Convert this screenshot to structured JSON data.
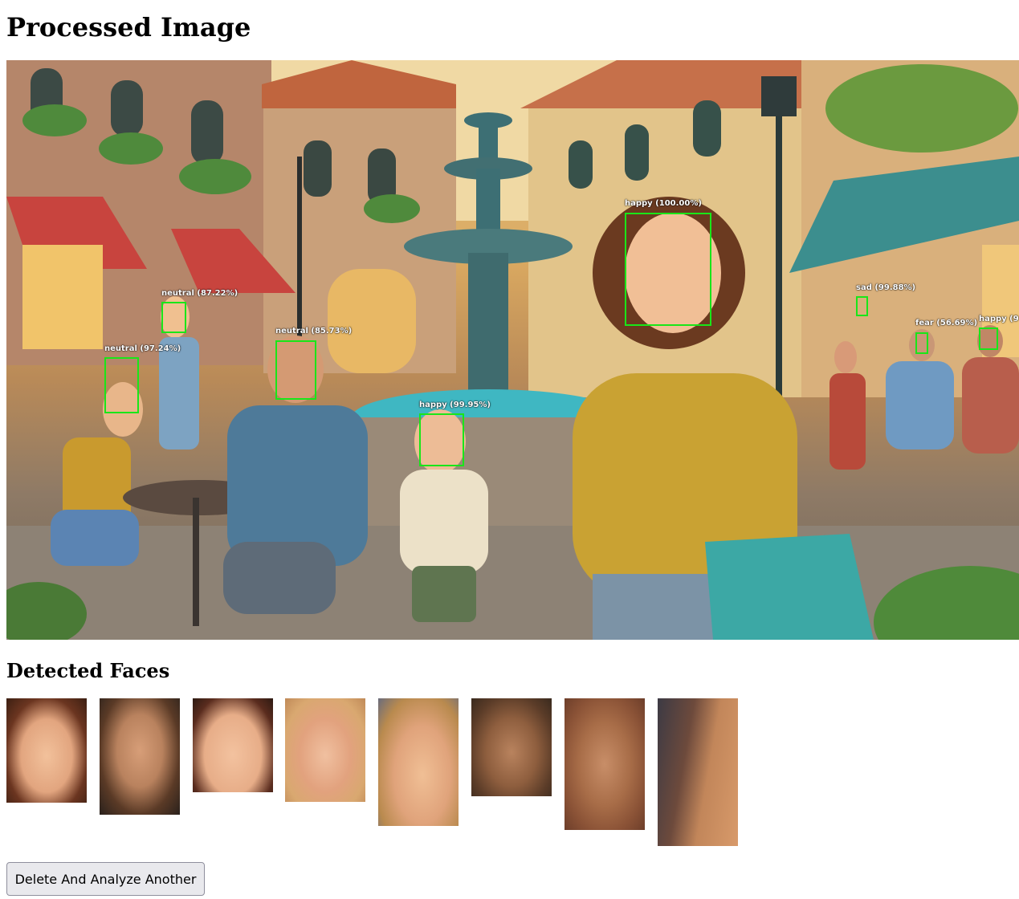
{
  "page": {
    "title": "Processed Image",
    "faces_heading": "Detected Faces",
    "button_label": "Delete And Analyze Another"
  },
  "detections": [
    {
      "label": "happy (100.00%)"
    },
    {
      "label": "neutral (87.22%)"
    },
    {
      "label": "neutral (97.24%)"
    },
    {
      "label": "neutral (85.73%)"
    },
    {
      "label": "happy (99.95%)"
    },
    {
      "label": "sad (99.88%)"
    },
    {
      "label": "fear (56.69%)"
    },
    {
      "label": "happy (9"
    }
  ],
  "colors": {
    "box": "#19e619",
    "button_bg": "#e9e9ed"
  }
}
